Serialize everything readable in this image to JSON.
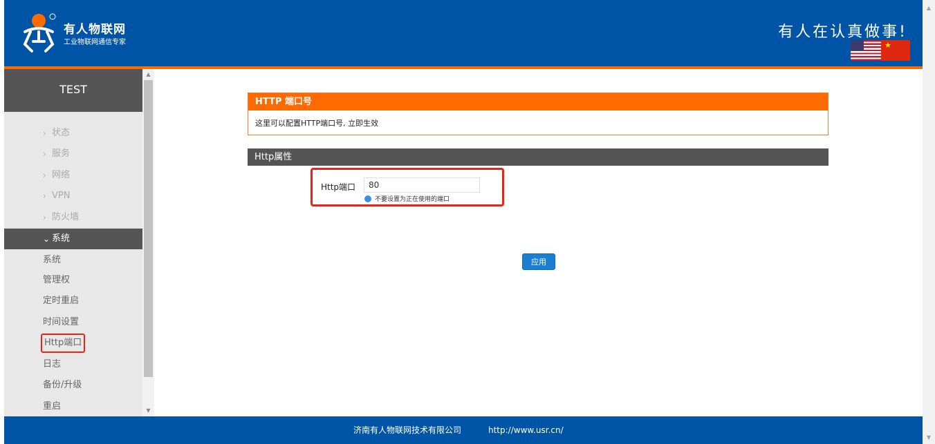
{
  "header": {
    "brand_name": "有人物联网",
    "brand_tagline": "工业物联网通信专家",
    "slogan": "有人在认真做事!",
    "languages": [
      "en",
      "zh"
    ]
  },
  "sidebar": {
    "device_name": "TEST",
    "menu": [
      {
        "label": "状态",
        "expanded": false
      },
      {
        "label": "服务",
        "expanded": false
      },
      {
        "label": "网络",
        "expanded": false
      },
      {
        "label": "VPN",
        "expanded": false
      },
      {
        "label": "防火墙",
        "expanded": false
      },
      {
        "label": "系统",
        "expanded": true
      }
    ],
    "submenu": [
      {
        "label": "系统"
      },
      {
        "label": "管理权"
      },
      {
        "label": "定时重启"
      },
      {
        "label": "时间设置"
      },
      {
        "label": "Http端口",
        "selected": true
      },
      {
        "label": "日志"
      },
      {
        "label": "备份/升级"
      },
      {
        "label": "重启"
      }
    ]
  },
  "main": {
    "info_title": "HTTP 端口号",
    "info_desc": "这里可以配置HTTP端口号, 立即生效",
    "section_title": "Http属性",
    "port_field": {
      "label": "Http端口",
      "value": "80",
      "hint": "不要设置为正在使用的端口"
    },
    "apply_label": "应用"
  },
  "footer": {
    "company": "济南有人物联网技术有限公司",
    "url": "http://www.usr.cn/"
  },
  "colors": {
    "header_blue": "#0054a6",
    "accent_orange": "#ff6a00",
    "dark_gray": "#555555",
    "highlight_red": "#e8231a",
    "button_blue": "#1a7fd4"
  }
}
